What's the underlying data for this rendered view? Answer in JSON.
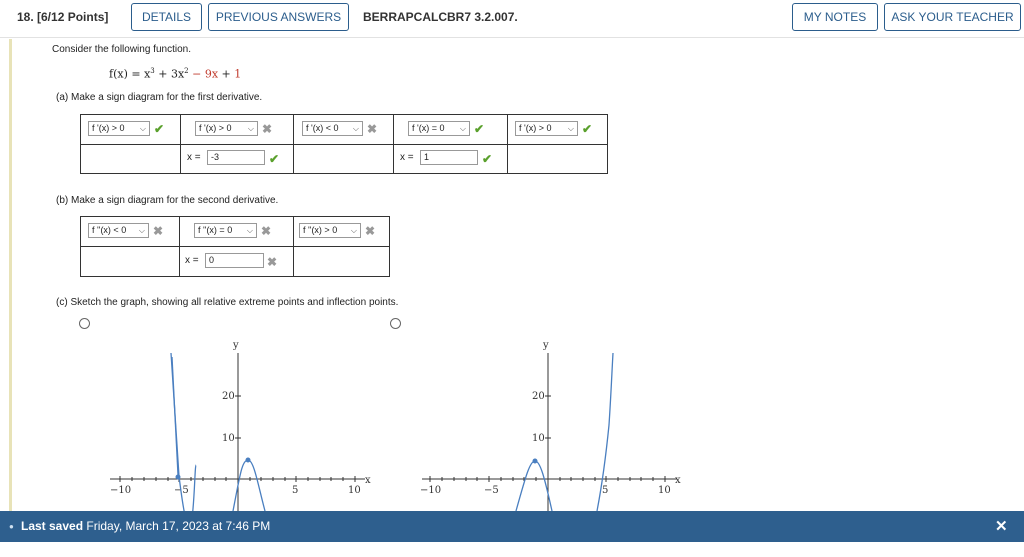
{
  "header": {
    "question_label": "18.  [6/12 Points]",
    "details_label": "DETAILS",
    "previous_answers_label": "PREVIOUS ANSWERS",
    "code": "BERRAPCALCBR7 3.2.007.",
    "my_notes_label": "MY NOTES",
    "ask_teacher_label": "ASK YOUR TEACHER"
  },
  "problem": {
    "intro": "Consider the following function.",
    "function_lhs": "f(x) = x",
    "function_mid": " + 3x",
    "function_red_a": " − 9x",
    "function_plus": " + ",
    "function_red_b": "1",
    "exp3": "3",
    "exp2": "2"
  },
  "part_a": {
    "prompt": "(a)   Make a sign diagram for the first derivative.",
    "selects": [
      "f '(x) > 0",
      "f '(x) > 0",
      "f '(x) < 0",
      "f '(x) = 0",
      "f '(x) > 0"
    ],
    "x_label_1": "x =",
    "x_value_1": "-3",
    "x_label_2": "x =",
    "x_value_2": "1"
  },
  "part_b": {
    "prompt": "(b)   Make a sign diagram for the second derivative.",
    "selects": [
      "f ''(x) < 0",
      "f ''(x) = 0",
      "f ''(x) > 0"
    ],
    "x_label": "x =",
    "x_value": "0"
  },
  "part_c": {
    "prompt": "(c)   Sketch the graph, showing all relative extreme points and inflection points."
  },
  "marks": {
    "check": "✔",
    "cross": "✖"
  },
  "graph_labels": {
    "y": "y",
    "x": "x",
    "x_ticks": [
      "−10",
      "−5",
      "5",
      "10"
    ],
    "y_ticks": [
      "20",
      "10"
    ]
  },
  "footer": {
    "saved_label": "Last saved",
    "saved_time": " Friday, March 17, 2023 at 7:46 PM",
    "close_icon": "✕"
  },
  "colors": {
    "accent": "#2b5d8c",
    "footer": "#2e5f8e",
    "correct": "#5aa02c",
    "incorrect": "#999999",
    "curve": "#4a7fc0"
  }
}
